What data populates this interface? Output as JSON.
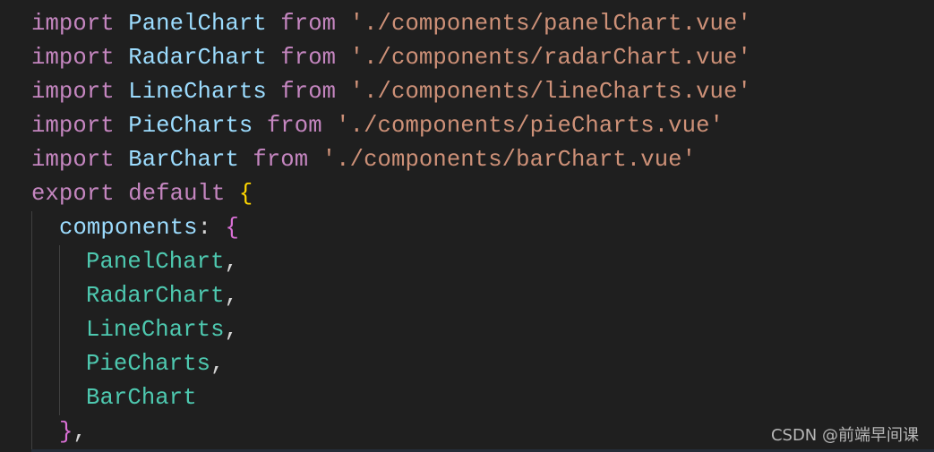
{
  "code": {
    "imports": [
      {
        "keyword": "import",
        "name": "PanelChart",
        "from": "from",
        "path": "'./components/panelChart.vue'"
      },
      {
        "keyword": "import",
        "name": "RadarChart",
        "from": "from",
        "path": "'./components/radarChart.vue'"
      },
      {
        "keyword": "import",
        "name": "LineCharts",
        "from": "from",
        "path": "'./components/lineCharts.vue'"
      },
      {
        "keyword": "import",
        "name": "PieCharts",
        "from": "from",
        "path": "'./components/pieCharts.vue'"
      },
      {
        "keyword": "import",
        "name": "BarChart",
        "from": "from",
        "path": "'./components/barChart.vue'"
      }
    ],
    "export_keyword": "export",
    "default_keyword": "default",
    "open_brace": "{",
    "components_key": "components",
    "colon": ":",
    "components_open": "{",
    "components": [
      {
        "name": "PanelChart",
        "sep": ","
      },
      {
        "name": "RadarChart",
        "sep": ","
      },
      {
        "name": "LineCharts",
        "sep": ","
      },
      {
        "name": "PieCharts",
        "sep": ","
      },
      {
        "name": "BarChart",
        "sep": ""
      }
    ],
    "components_close": "}",
    "close_sep": ","
  },
  "watermark": "CSDN @前端早间课",
  "colors": {
    "background": "#1f1f1f",
    "keyword": "#c586c0",
    "identifier": "#9cdcfe",
    "string": "#ce9178",
    "class": "#4ec9b0"
  }
}
